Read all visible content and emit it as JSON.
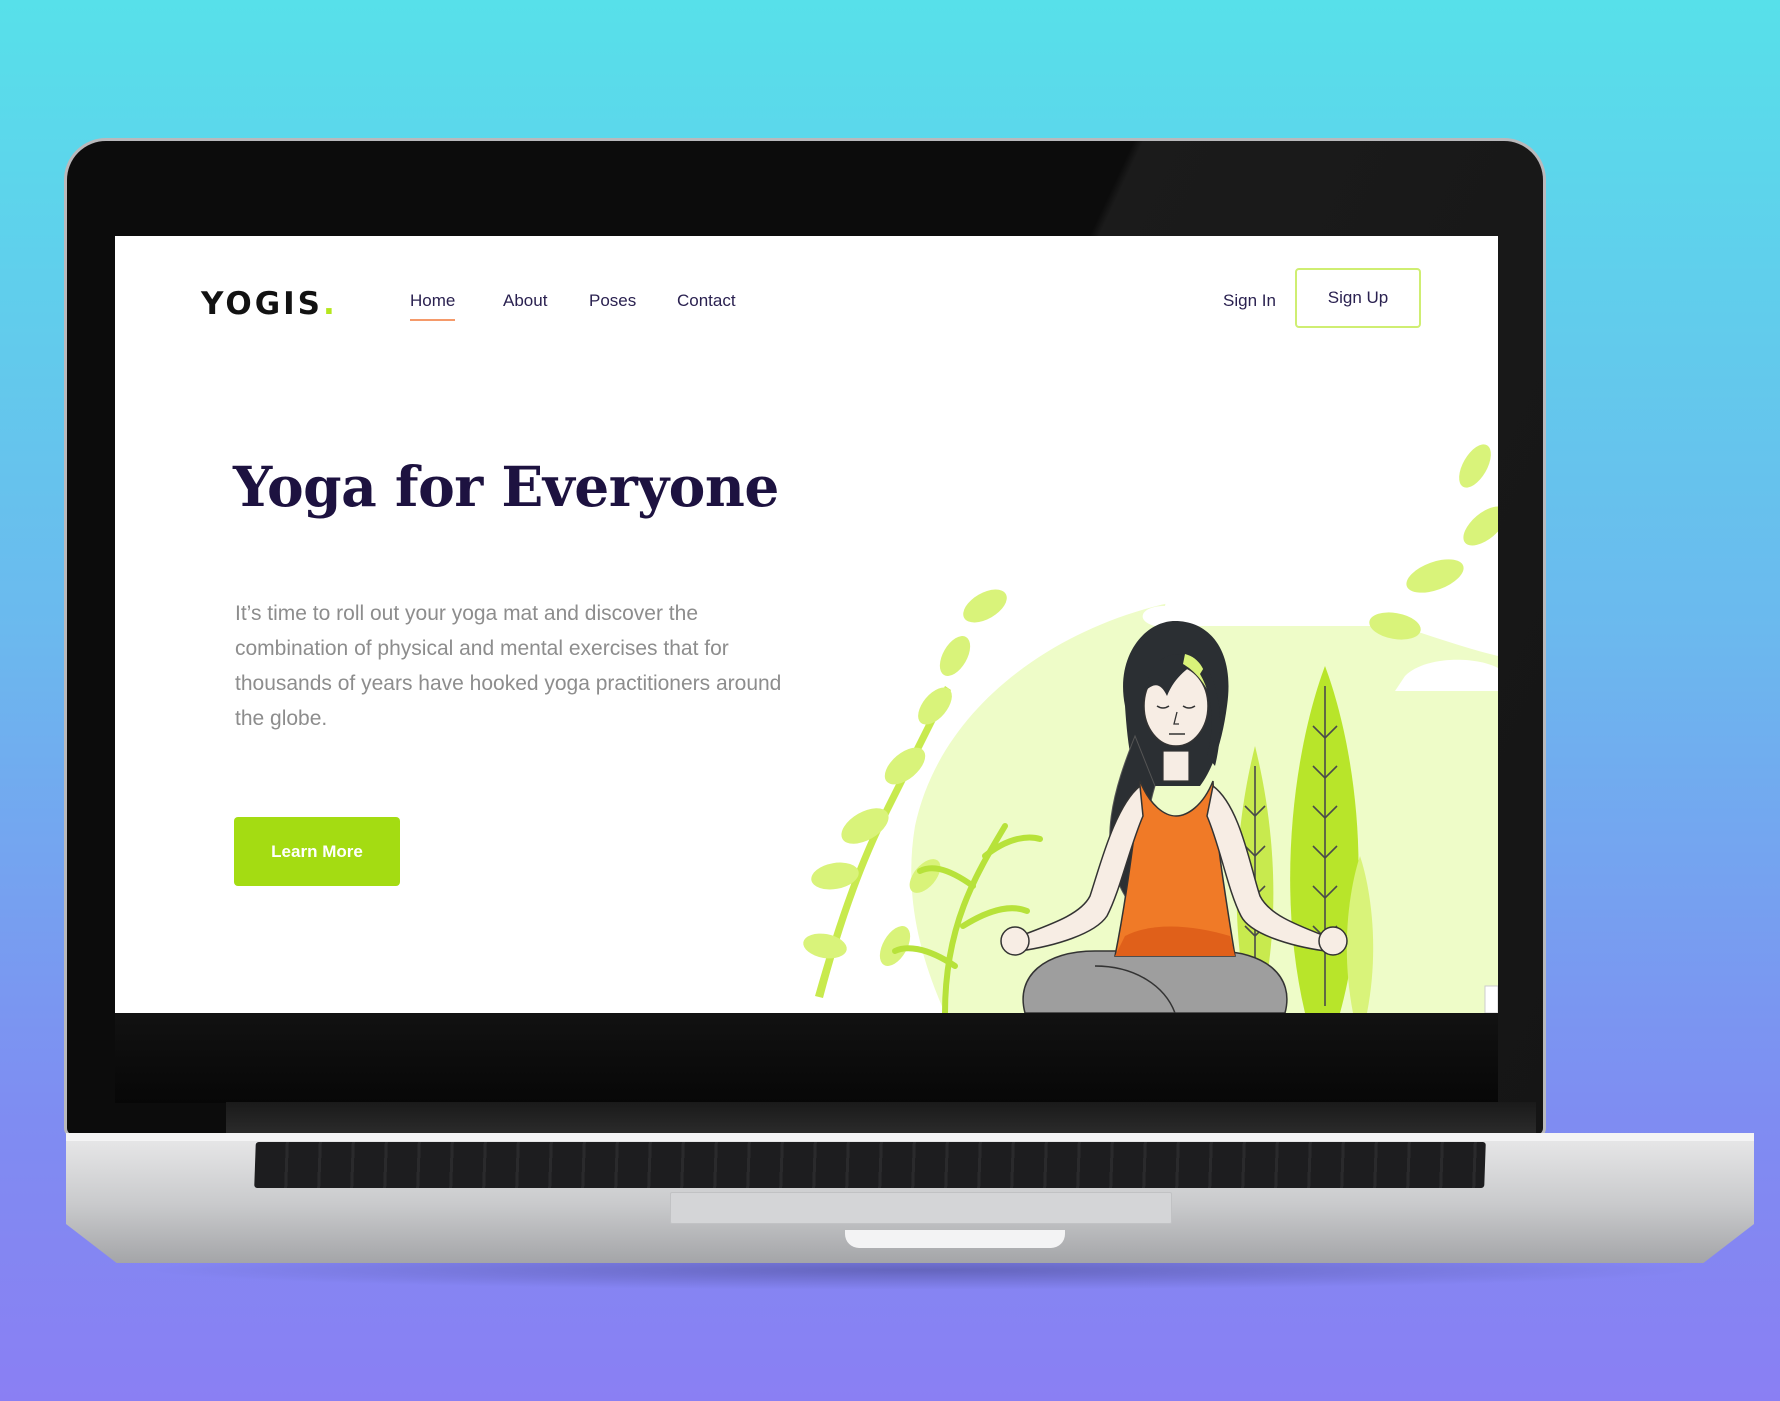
{
  "site": {
    "logo_text": "YOGIS",
    "logo_dot": ".",
    "nav": {
      "links": [
        {
          "label": "Home",
          "active": true
        },
        {
          "label": "About"
        },
        {
          "label": "Poses"
        },
        {
          "label": "Contact"
        }
      ],
      "sign_in": "Sign In",
      "sign_up": "Sign Up"
    },
    "hero": {
      "title": "Yoga for Everyone",
      "description": "It’s time to roll out your yoga mat and discover the combination of physical and mental exercises that for thousands of years have hooked yoga practitioners around the globe.",
      "cta": "Learn More"
    },
    "illustration": {
      "subject": "woman meditating in lotus pose among plants",
      "icon": "meditation-illustration"
    }
  },
  "colors": {
    "accent_green": "#a4dc12",
    "logo_dot": "#b5e61d",
    "title": "#1d1240",
    "nav_text": "#2a2150",
    "active_underline": "#f59a6a",
    "tank_top": "#f07a27",
    "light_green": "#eefcc8"
  }
}
